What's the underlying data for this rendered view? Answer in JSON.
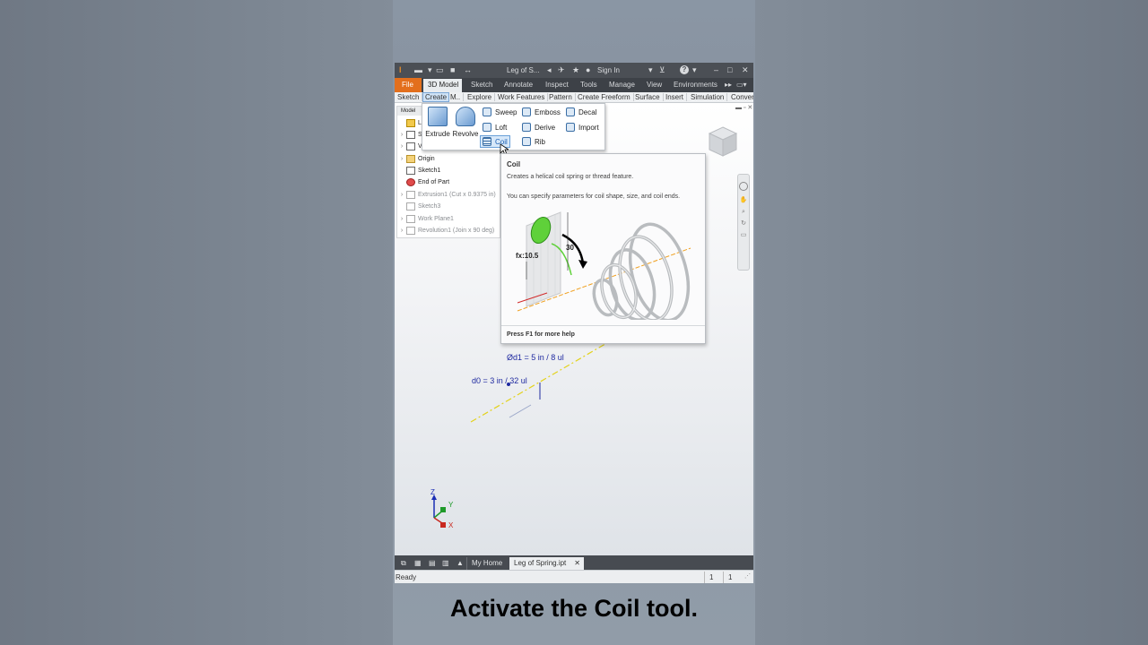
{
  "title_bar": {
    "doc_title": "Leg of S...",
    "sign_in": "Sign In",
    "help_glyph": "?"
  },
  "tabs": {
    "file": "File",
    "items": [
      "3D Model",
      "Sketch",
      "Annotate",
      "Inspect",
      "Tools",
      "Manage",
      "View",
      "Environments"
    ]
  },
  "ribbon_panels": [
    "Sketch",
    "Create",
    "M..",
    "Explore",
    "Work Features",
    "Pattern",
    "Create Freeform",
    "Surface",
    "Insert",
    "Simulation",
    "Conver"
  ],
  "browser": {
    "header": "Model",
    "items": [
      {
        "label": "Leg",
        "dim": false,
        "chev": ""
      },
      {
        "label": "S",
        "dim": false,
        "chev": "›"
      },
      {
        "label": "V",
        "dim": false,
        "chev": "›"
      },
      {
        "label": "Origin",
        "dim": false,
        "chev": "›"
      },
      {
        "label": "Sketch1",
        "dim": false,
        "chev": ""
      },
      {
        "label": "End of Part",
        "dim": false,
        "chev": ""
      },
      {
        "label": "Extrusion1 (Cut x 0.9375 in)",
        "dim": true,
        "chev": "›"
      },
      {
        "label": "Sketch3",
        "dim": true,
        "chev": ""
      },
      {
        "label": "Work Plane1",
        "dim": true,
        "chev": "›"
      },
      {
        "label": "Revolution1 (Join x 90 deg)",
        "dim": true,
        "chev": "›"
      }
    ]
  },
  "create_menu": {
    "extrude": "Extrude",
    "revolve": "Revolve",
    "sweep": "Sweep",
    "loft": "Loft",
    "coil": "Coil",
    "emboss": "Emboss",
    "derive": "Derive",
    "rib": "Rib",
    "decal": "Decal",
    "import": "Import"
  },
  "tooltip": {
    "title": "Coil",
    "description": "Creates a helical coil spring or thread feature.",
    "detail": "You can specify parameters for coil shape, size, and coil ends.",
    "fx_label": "fx:10.5",
    "angle_label": "30",
    "footer": "Press F1 for more help"
  },
  "sketch_dims": {
    "d1": "Ød1 = 5 in / 8 ul",
    "d0": "d0 = 3 in / 32 ul"
  },
  "axes": {
    "x": "X",
    "y": "Y",
    "z": "Z"
  },
  "doc_tabs": {
    "home": "My Home",
    "active": "Leg of Spring.ipt"
  },
  "status": {
    "text": "Ready",
    "count1": "1",
    "count2": "1"
  },
  "caption": "Activate the Coil tool.",
  "colors": {
    "file_tab": "#e36f1c",
    "dimension_text": "#1f2aa0",
    "sketch_axis": "#e3d21a",
    "coil_green": "#5fd13a"
  }
}
